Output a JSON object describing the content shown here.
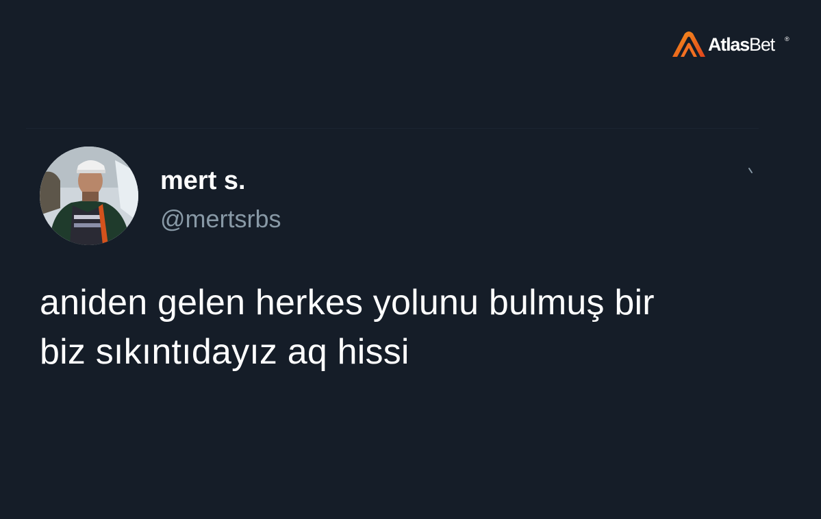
{
  "brand": {
    "name_bold": "Atlas",
    "name_light": "Bet",
    "registered": "®",
    "accent_color": "#f37021"
  },
  "tweet": {
    "author": {
      "display_name": "mert s.",
      "handle": "@mertsrbs"
    },
    "text_lines": [
      "aniden gelen herkes yolunu bulmuş bir",
      "biz sıkıntıdayız aq hissi"
    ],
    "more_icon": "caret-down-icon"
  },
  "colors": {
    "background": "#151d28",
    "text": "#ffffff",
    "secondary_text": "#8899a6"
  }
}
